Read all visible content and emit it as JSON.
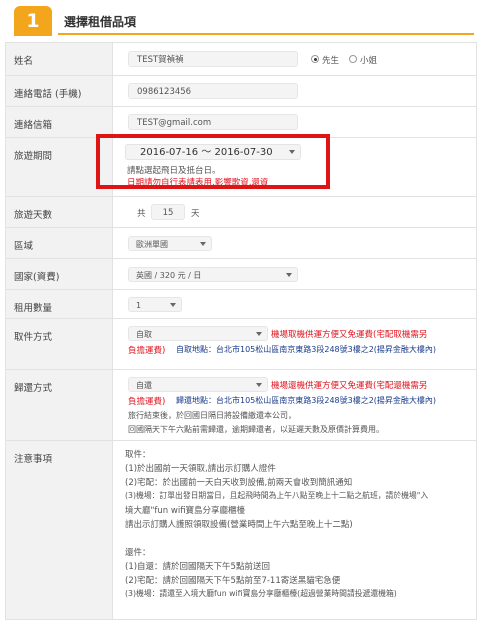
{
  "header": {
    "step_number": "1",
    "title": "選擇租借品項"
  },
  "rows": {
    "name": {
      "label": "姓名",
      "value": "TEST賀禎禎",
      "gender": {
        "options": [
          "先生",
          "小姐"
        ],
        "selected": "先生"
      }
    },
    "phone": {
      "label": "連絡電話 (手機)",
      "value": "0986123456"
    },
    "email": {
      "label": "連絡信箱",
      "value": "TEST@gmail.com"
    },
    "travel_period": {
      "label": "旅遊期間",
      "value": "2016-07-16 ～ 2016-07-30",
      "note1": "請點選起飛日及抵台日。",
      "note2": "日期請勿自行表請表用,影響歌資,還資"
    },
    "days": {
      "label": "旅遊天數",
      "prefix": "共",
      "value": "15",
      "suffix": "天"
    },
    "region": {
      "label": "區域",
      "value": "歐洲單國"
    },
    "country": {
      "label": "國家(資費)",
      "value": "英國 / 320 元 / 日"
    },
    "quantity": {
      "label": "租用數量",
      "value": "1"
    },
    "pickup": {
      "label": "取件方式",
      "value": "自取",
      "note_line1": "機場取機供運方便又免運費(宅配取機需另",
      "note_line2": "負擔運費)",
      "address": "自取地點：台北市105松山區南京東路3段248號3樓之2(揚昇金融大樓內)"
    },
    "return": {
      "label": "歸還方式",
      "value": "自還",
      "note_line1": "機場還機供運方便又免運費(宅配還機需另",
      "note_line2": "負擔運費)",
      "address": "歸還地點：台北市105松山區南京東路3段248號3樓之2(揚昇金融大樓內)",
      "line3": "旅行結束後，於回國日隔日將設備繳還本公司，",
      "line4": "回國隔天下午六點前需歸還，逾期歸還者，以延遲天數及原價計算費用。"
    },
    "notes": {
      "label": "注意事項",
      "lines": [
        "取件：",
        "(1)於出國前一天領取,請出示訂購人證件",
        "(2)宅配：於出國前一天白天收到設備,前兩天會收到簡訊通知",
        "(3)機場：訂單出發日期當日，且起飛時間為上午八點至晚上十二點之航班，請於機場\"入",
        "境大廳\"fun wifi寶島分享廳櫃檯",
        "請出示訂購人護照領取設備(營業時間上午六點至晚上十二點)",
        "",
        "還件：",
        "(1)自還：請於回國隔天下午5點前送回",
        "(2)宅配：請於回國隔天下午5點前至7-11寄送黑貓宅急便",
        "(3)機場：請還至入境大廳fun wifi寶島分享廳櫃檯(超過營業時間請投遞還機箱)"
      ]
    }
  }
}
